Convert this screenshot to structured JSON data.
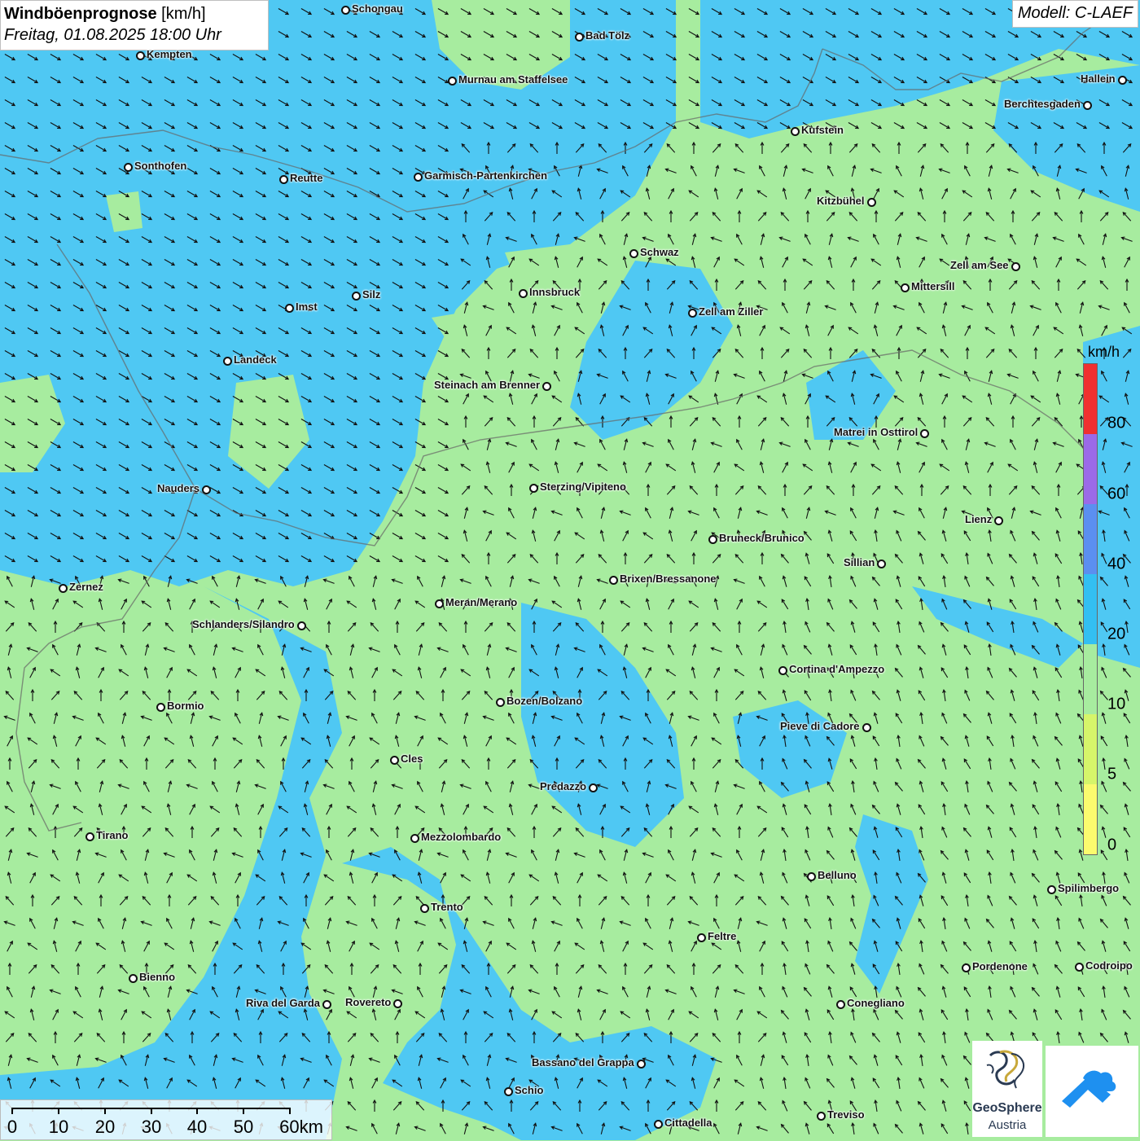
{
  "title": {
    "main": "Windböenprognose",
    "unit": "[km/h]",
    "datetime": "Freitag, 01.08.2025 18:00 Uhr"
  },
  "model_label": "Modell: C-LAEF",
  "legend": {
    "unit": "km/h",
    "labels": [
      "80",
      "60",
      "40",
      "20",
      "10",
      "5",
      "0"
    ],
    "colors": [
      "#f03030",
      "#9b6ae8",
      "#5b8ff0",
      "#33bff2",
      "#a7ec9f",
      "#d6f56a",
      "#fbfb6e"
    ]
  },
  "scale": {
    "labels": [
      "0",
      "10",
      "20",
      "30",
      "40",
      "50",
      "60km"
    ]
  },
  "logos": {
    "geosphere_line1": "GeoSphere",
    "geosphere_line2": "Austria"
  },
  "colors": {
    "calm": "#a7ec9f",
    "moderate": "#4fc8f3"
  },
  "cities": [
    {
      "name": "Schongau"
    },
    {
      "name": "Bad Tölz"
    },
    {
      "name": "Kempten"
    },
    {
      "name": "Murnau am Staffelsee"
    },
    {
      "name": "Hallein"
    },
    {
      "name": "Berchtesgaden"
    },
    {
      "name": "Kufstein"
    },
    {
      "name": "Sonthofen"
    },
    {
      "name": "Reutte"
    },
    {
      "name": "Garmisch-Partenkirchen"
    },
    {
      "name": "Kitzbühel"
    },
    {
      "name": "Schwaz"
    },
    {
      "name": "Zell am See"
    },
    {
      "name": "Innsbruck"
    },
    {
      "name": "Mittersill"
    },
    {
      "name": "Silz"
    },
    {
      "name": "Imst"
    },
    {
      "name": "Zell am Ziller"
    },
    {
      "name": "Landeck"
    },
    {
      "name": "Steinach am Brenner"
    },
    {
      "name": "Matrei in Osttirol"
    },
    {
      "name": "Nauders"
    },
    {
      "name": "Sterzing/Vipiteno"
    },
    {
      "name": "Lienz"
    },
    {
      "name": "Bruneck/Brunico"
    },
    {
      "name": "Sillian"
    },
    {
      "name": "Brixen/Bressanone"
    },
    {
      "name": "Zernez"
    },
    {
      "name": "Meran/Merano"
    },
    {
      "name": "Schlanders/Silandro"
    },
    {
      "name": "Cortina d'Ampezzo"
    },
    {
      "name": "Bozen/Bolzano"
    },
    {
      "name": "Bormio"
    },
    {
      "name": "Pieve di Cadore"
    },
    {
      "name": "Cles"
    },
    {
      "name": "Predazzo"
    },
    {
      "name": "Tirano"
    },
    {
      "name": "Mezzolombardo"
    },
    {
      "name": "Belluno"
    },
    {
      "name": "Spilimbergo"
    },
    {
      "name": "Trento"
    },
    {
      "name": "Feltre"
    },
    {
      "name": "Pordenone"
    },
    {
      "name": "Codroipo"
    },
    {
      "name": "Bienno"
    },
    {
      "name": "Riva del Garda"
    },
    {
      "name": "Rovereto"
    },
    {
      "name": "Conegliano"
    },
    {
      "name": "Bassano del Grappa"
    },
    {
      "name": "Schio"
    },
    {
      "name": "Treviso"
    },
    {
      "name": "Cittadella"
    }
  ]
}
